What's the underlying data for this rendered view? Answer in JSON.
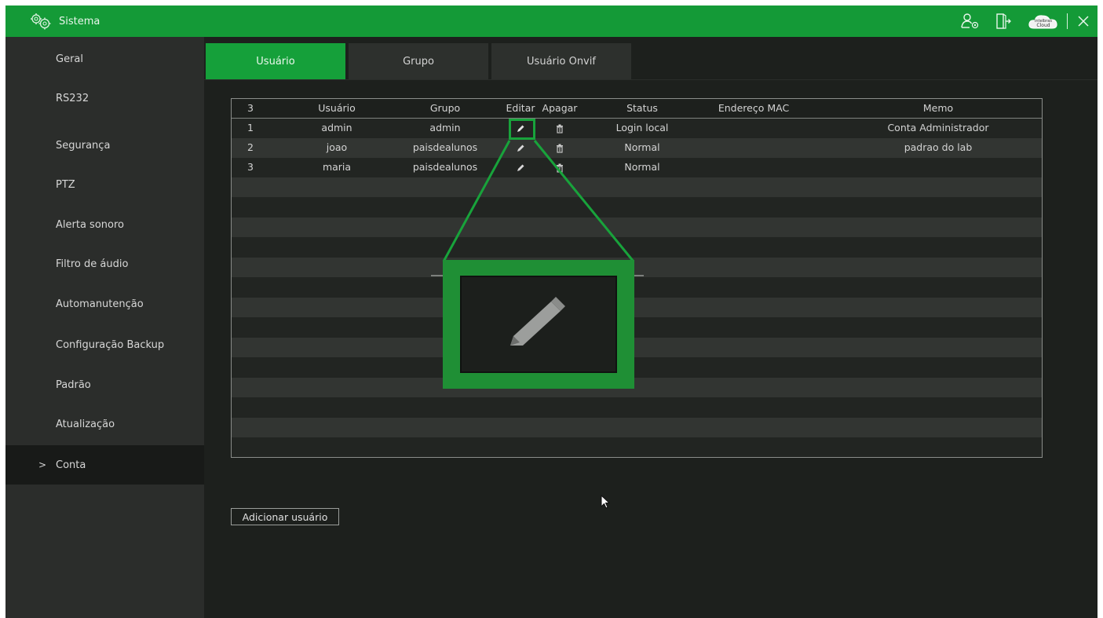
{
  "app": {
    "title": "Sistema"
  },
  "colors": {
    "accent": "#149a37",
    "sidebar": "#2b2d2b",
    "background": "#1c1e1c"
  },
  "titlebar_icons": [
    "gears-icon",
    "user-settings-icon",
    "logout-icon",
    "intelbras-cloud-icon",
    "close-icon"
  ],
  "cloud_badge": {
    "brand": "intelbras",
    "label": "Cloud"
  },
  "sidebar": {
    "items": [
      {
        "label": "Geral",
        "active": false
      },
      {
        "label": "RS232",
        "active": false
      },
      {
        "label": "Segurança",
        "active": false
      },
      {
        "label": "PTZ",
        "active": false
      },
      {
        "label": "Alerta sonoro",
        "active": false
      },
      {
        "label": "Filtro de áudio",
        "active": false
      },
      {
        "label": "Automanutenção",
        "active": false
      },
      {
        "label": "Configuração Backup",
        "active": false
      },
      {
        "label": "Padrão",
        "active": false
      },
      {
        "label": "Atualização",
        "active": false
      },
      {
        "label": "Conta",
        "active": true
      }
    ],
    "active_chevron": ">"
  },
  "tabs": [
    {
      "label": "Usuário",
      "active": true
    },
    {
      "label": "Grupo",
      "active": false
    },
    {
      "label": "Usuário Onvif",
      "active": false
    }
  ],
  "table": {
    "header": {
      "count": "3",
      "user": "Usuário",
      "group": "Grupo",
      "edit": "Editar",
      "delete": "Apagar",
      "status": "Status",
      "mac": "Endereço MAC",
      "memo": "Memo"
    },
    "rows": [
      {
        "num": "1",
        "user": "admin",
        "group": "admin",
        "status": "Login local",
        "mac": "",
        "memo": "Conta Administrador"
      },
      {
        "num": "2",
        "user": "joao",
        "group": "paisdealunos",
        "status": "Normal",
        "mac": "",
        "memo": "padrao do lab"
      },
      {
        "num": "3",
        "user": "maria",
        "group": "paisdealunos",
        "status": "Normal",
        "mac": "",
        "memo": ""
      }
    ]
  },
  "buttons": {
    "add_user": "Adicionar usuário"
  }
}
